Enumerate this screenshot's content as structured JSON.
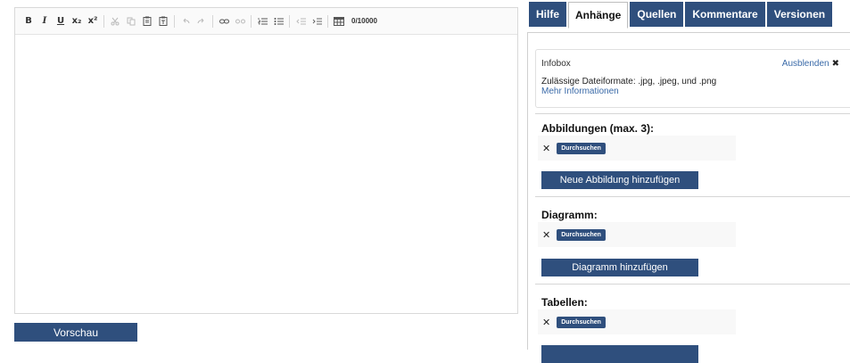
{
  "editor": {
    "toolbar": {
      "bold": "B",
      "italic": "I",
      "underline": "U",
      "subscript": "x₂",
      "superscript": "x²",
      "counter": "0/10000"
    },
    "content": ""
  },
  "preview_label": "Vorschau",
  "tabs": [
    {
      "label": "Hilfe",
      "active": false
    },
    {
      "label": "Anhänge",
      "active": true
    },
    {
      "label": "Quellen",
      "active": false
    },
    {
      "label": "Kommentare",
      "active": false
    },
    {
      "label": "Versionen",
      "active": false
    }
  ],
  "infobox": {
    "title": "Infobox",
    "hide_label": "Ausblenden",
    "text": "Zulässige Dateiformate: .jpg, .jpeg, und .png",
    "link": "Mehr Informationen"
  },
  "sections": {
    "images": {
      "title": "Abbildungen (max. 3):",
      "browse": "Durchsuchen",
      "add": "Neue Abbildung hinzufügen"
    },
    "diagram": {
      "title": "Diagramm:",
      "browse": "Durchsuchen",
      "add": "Diagramm hinzufügen"
    },
    "tables": {
      "title": "Tabellen:",
      "browse": "Durchsuchen"
    }
  },
  "colors": {
    "accent": "#2f4f7d",
    "link": "#3a6aa8"
  }
}
